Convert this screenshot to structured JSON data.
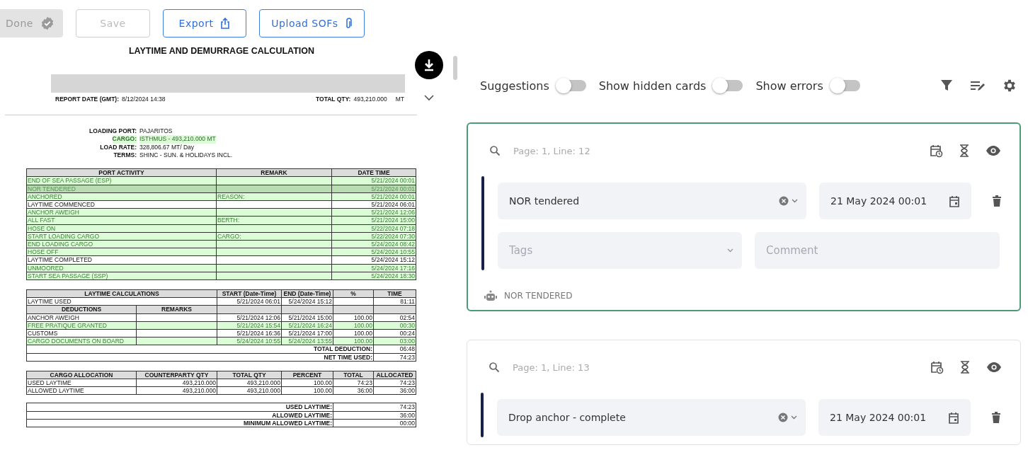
{
  "toolbar": {
    "buttons": [
      {
        "label": "Done",
        "kind": "done",
        "disabled": true
      },
      {
        "label": "Save",
        "kind": "save",
        "disabled": true
      },
      {
        "label": "Export",
        "kind": "export",
        "disabled": false
      },
      {
        "label": "Upload SOFs",
        "kind": "upload",
        "disabled": false
      }
    ]
  },
  "document": {
    "title": "LAYTIME AND DEMURRAGE CALCULATION",
    "header_left": {
      "label": "REPORT DATE (GMT):",
      "value": "8/12/2024 14:38"
    },
    "header_right": {
      "label": "TOTAL QTY:",
      "value": "493,210.000",
      "unit": "MT"
    },
    "info": [
      {
        "label": "LOADING PORT:",
        "value": "PAJARITOS",
        "highlight": false
      },
      {
        "label": "CARGO:",
        "value": "ISTHMUS - 493,210.000 MT",
        "highlight": true
      },
      {
        "label": "LOAD RATE:",
        "value": "328,806.67 MT/ Day",
        "highlight": false
      },
      {
        "label": "TERMS:",
        "value": "SHINC - SUN. & HOLIDAYS INCL.",
        "highlight": false
      }
    ],
    "port_activity": {
      "columns": [
        "PORT ACTIVITY",
        "REMARK",
        "DATE TIME"
      ],
      "rows": [
        {
          "activity": "END OF SEA PASSAGE (ESP)",
          "remark": "",
          "datetime": "5/21/2024 00:01",
          "highlight": true,
          "selected": false
        },
        {
          "activity": "NOR TENDERED",
          "remark": "",
          "datetime": "5/21/2024 00:01",
          "highlight": true,
          "selected": true
        },
        {
          "activity": "ANCHORED",
          "remark": "REASON:",
          "datetime": "5/21/2024 00:01",
          "highlight": true,
          "selected": false
        },
        {
          "activity": "LAYTIME COMMENCED",
          "remark": "",
          "datetime": "5/21/2024 06:01",
          "highlight": false,
          "selected": false
        },
        {
          "activity": "ANCHOR AWEIGH",
          "remark": "",
          "datetime": "5/21/2024 12:06",
          "highlight": true,
          "selected": false
        },
        {
          "activity": "ALL FAST",
          "remark": "BERTH:",
          "datetime": "5/21/2024 15:00",
          "highlight": true,
          "selected": false
        },
        {
          "activity": "HOSE ON",
          "remark": "",
          "datetime": "5/22/2024 07:18",
          "highlight": true,
          "selected": false
        },
        {
          "activity": "START LOADING CARGO",
          "remark": "CARGO:",
          "datetime": "5/22/2024 07:30",
          "highlight": true,
          "selected": false
        },
        {
          "activity": "END LOADING CARGO",
          "remark": "",
          "datetime": "5/24/2024 08:42",
          "highlight": true,
          "selected": false
        },
        {
          "activity": "HOSE OFF",
          "remark": "",
          "datetime": "5/24/2024 10:55",
          "highlight": true,
          "selected": false
        },
        {
          "activity": "LAYTIME COMPLETED",
          "remark": "",
          "datetime": "5/24/2024 15:12",
          "highlight": false,
          "selected": false
        },
        {
          "activity": "UNMOORED",
          "remark": "",
          "datetime": "5/24/2024 17:16",
          "highlight": true,
          "selected": false
        },
        {
          "activity": "START SEA PASSAGE (SSP)",
          "remark": "",
          "datetime": "5/24/2024 18:30",
          "highlight": true,
          "selected": false
        }
      ]
    },
    "laytime": {
      "columns": [
        "LAYTIME CALCULATIONS",
        "START (Date-Time)",
        "END (Date-Time)",
        "%",
        "TIME"
      ],
      "used": {
        "label": "LAYTIME USED",
        "start": "5/21/2024 06:01",
        "end": "5/24/2024 15:12",
        "time": "81:11"
      },
      "deduction_columns": [
        "DEDUCTIONS",
        "REMARKS"
      ],
      "deductions": [
        {
          "name": "ANCHOR AWEIGH",
          "start": "5/21/2024 12:06",
          "end": "5/21/2024 15:00",
          "percent": "100.00",
          "time": "02:54",
          "highlight": false
        },
        {
          "name": "FREE PRATIQUE GRANTED",
          "start": "5/21/2024 15:54",
          "end": "5/21/2024 16:24",
          "percent": "100.00",
          "time": "00:30",
          "highlight": true
        },
        {
          "name": "CUSTOMS",
          "start": "5/21/2024 16:36",
          "end": "5/21/2024 17:00",
          "percent": "100.00",
          "time": "00:24",
          "highlight": false
        },
        {
          "name": "CARGO DOCUMENTS ON BOARD",
          "start": "5/24/2024 10:55",
          "end": "5/24/2024 13:55",
          "percent": "100.00",
          "time": "03:00",
          "highlight": true
        }
      ],
      "totals": [
        {
          "label": "TOTAL DEDUCTION:",
          "value": "06:48"
        },
        {
          "label": "NET TIME USED:",
          "value": "74:23"
        }
      ]
    },
    "cargo_allocation": {
      "columns": [
        "CARGO ALLOCATION",
        "COUNTERPARTY QTY",
        "TOTAL QTY",
        "PERCENT",
        "TOTAL",
        "ALLOCATED"
      ],
      "rows": [
        [
          "USED LAYTIME",
          "493,210.000",
          "493,210.000",
          "100.00",
          "74:23",
          "74:23"
        ],
        [
          "ALLOWED LAYTIME",
          "493,210.000",
          "493,210.000",
          "100.00",
          "36:00",
          "36:00"
        ]
      ]
    },
    "summary": [
      {
        "label": "USED LAYTIME:",
        "value": "74:23"
      },
      {
        "label": "ALLOWED LAYTIME:",
        "value": "36:00"
      },
      {
        "label": "MINIMUM ALLOWED LAYTIME:",
        "value": "00:00"
      }
    ]
  },
  "filters": [
    {
      "label": "Suggestions",
      "on": false
    },
    {
      "label": "Show hidden cards",
      "on": false
    },
    {
      "label": "Show errors",
      "on": false
    }
  ],
  "cards": [
    {
      "selected": true,
      "page_ref": "Page: 1, Line: 12",
      "event": "NOR tendered",
      "datetime": "21 May 2024 00:01",
      "tags": {
        "placeholder": "Tags"
      },
      "comment": {
        "placeholder": "Comment"
      },
      "source": "NOR TENDERED"
    },
    {
      "selected": false,
      "page_ref": "Page: 1, Line: 13",
      "event": "Drop anchor - complete",
      "datetime": "21 May 2024 00:01"
    }
  ]
}
